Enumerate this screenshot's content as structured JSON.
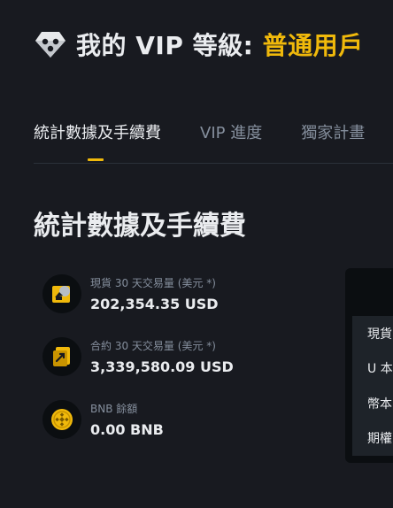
{
  "colors": {
    "accent": "#f0b90b",
    "background": "#181a20",
    "text_primary": "#eaecef",
    "text_secondary": "#848e9c"
  },
  "header": {
    "icon": "diamond-icon",
    "title_prefix": "我的 VIP 等級: ",
    "level": "普通用戶"
  },
  "tabs": [
    {
      "label": "統計數據及手續費",
      "active": true
    },
    {
      "label": "VIP 進度",
      "active": false
    },
    {
      "label": "獨家計畫",
      "active": false
    }
  ],
  "section": {
    "heading": "統計數據及手續費"
  },
  "stats": [
    {
      "icon": "spot-volume-icon",
      "label": "現貨 30 天交易量 (美元 *)",
      "value": "202,354.35 USD"
    },
    {
      "icon": "futures-volume-icon",
      "label": "合約 30 天交易量 (美元 *)",
      "value": "3,339,580.09 USD"
    },
    {
      "icon": "bnb-icon",
      "label": "BNB 餘額",
      "value": "0.00 BNB"
    }
  ],
  "side_panel": {
    "rows": [
      "現貨",
      "U 本",
      "幣本",
      "期權"
    ]
  }
}
